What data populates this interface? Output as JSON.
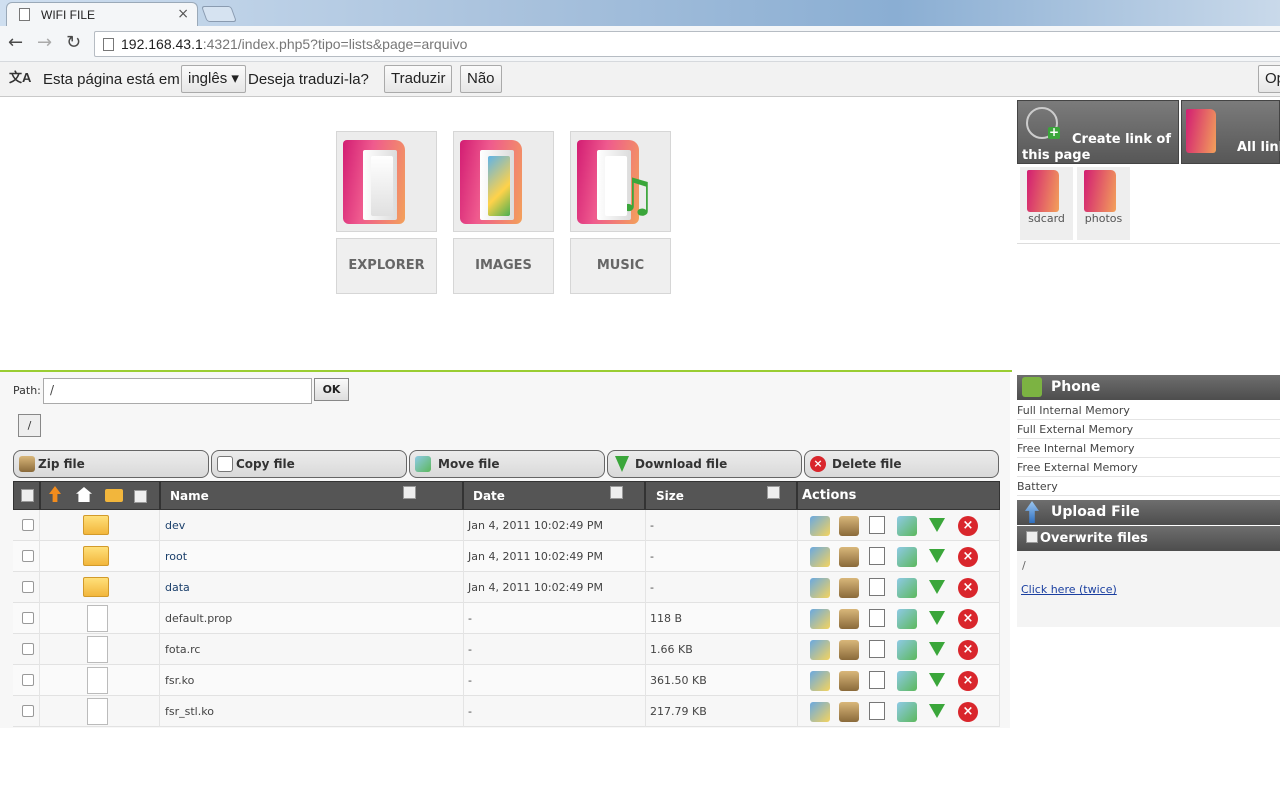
{
  "browser": {
    "tab_title": "WIFI FILE",
    "tab_close": "×",
    "url_host": "192.168.43.1",
    "url_rest": ":4321/index.php5?tipo=lists&page=arquivo",
    "back": "←",
    "forward": "→",
    "reload": "↻"
  },
  "translate_bar": {
    "icon_text": "文A",
    "prefix": "Esta página está em",
    "language": "inglês ▾",
    "question": "Deseja traduzi-la?",
    "translate_btn": "Traduzir",
    "no_btn": "Não",
    "options_btn": "Op"
  },
  "tiles": [
    {
      "label": "EXPLORER"
    },
    {
      "label": "IMAGES"
    },
    {
      "label": "MUSIC"
    }
  ],
  "right_panel": {
    "create_link": "Create link of this page",
    "all_links": "All link",
    "shortcuts": [
      "sdcard",
      "photos"
    ]
  },
  "path": {
    "label": "Path:",
    "value": "/",
    "ok": "OK",
    "root": "/"
  },
  "actions_bar": {
    "zip": "Zip file",
    "copy": "Copy file",
    "move": "Move file",
    "download": "Download file",
    "delete": "Delete file"
  },
  "table": {
    "col_name": "Name",
    "col_date": "Date",
    "col_size": "Size",
    "col_actions": "Actions",
    "rows": [
      {
        "name": "dev",
        "date": "Jan 4, 2011 10:02:49 PM",
        "size": "-",
        "type": "folder"
      },
      {
        "name": "root",
        "date": "Jan 4, 2011 10:02:49 PM",
        "size": "-",
        "type": "folder"
      },
      {
        "name": "data",
        "date": "Jan 4, 2011 10:02:49 PM",
        "size": "-",
        "type": "folder"
      },
      {
        "name": "default.prop",
        "date": "-",
        "size": "118 B",
        "type": "file"
      },
      {
        "name": "fota.rc",
        "date": "-",
        "size": "1.66 KB",
        "type": "file"
      },
      {
        "name": "fsr.ko",
        "date": "-",
        "size": "361.50 KB",
        "type": "file"
      },
      {
        "name": "fsr_stl.ko",
        "date": "-",
        "size": "217.79 KB",
        "type": "file"
      }
    ]
  },
  "phone": {
    "title": "Phone",
    "items": [
      "Full Internal Memory",
      "Full External Memory",
      "Free Internal Memory",
      "Free External Memory",
      "Battery"
    ]
  },
  "upload": {
    "title": "Upload File",
    "overwrite": "Overwrite files",
    "path": "/",
    "click_here": "Click here (twice)"
  }
}
